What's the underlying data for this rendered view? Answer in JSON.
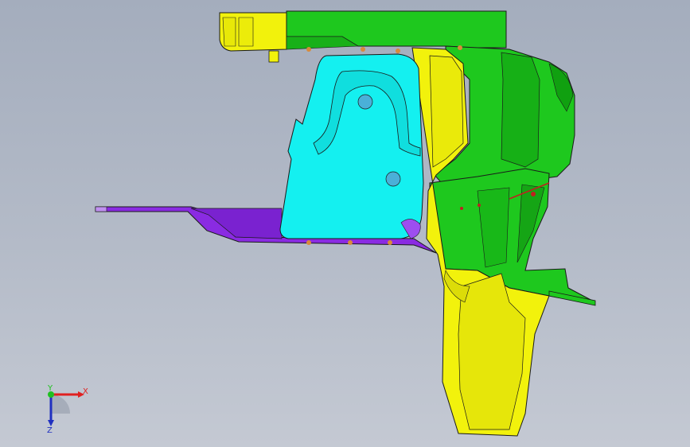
{
  "viewport": {
    "background_top": "#a4adbd",
    "background_bottom": "#c4c9d3"
  },
  "model": {
    "colors": {
      "yellow": "#f2f20c",
      "green": "#1ec81e",
      "cyan": "#14f0f0",
      "purple": "#8a2be2",
      "edge": "#1a1a1a",
      "hole": "#4ab0d8",
      "screw": "#d98a3a"
    }
  },
  "triad": {
    "x_label": "X",
    "y_label": "Y",
    "z_label": "Z",
    "x_color": "#e02020",
    "y_color": "#20c020",
    "z_color": "#2030c0"
  }
}
